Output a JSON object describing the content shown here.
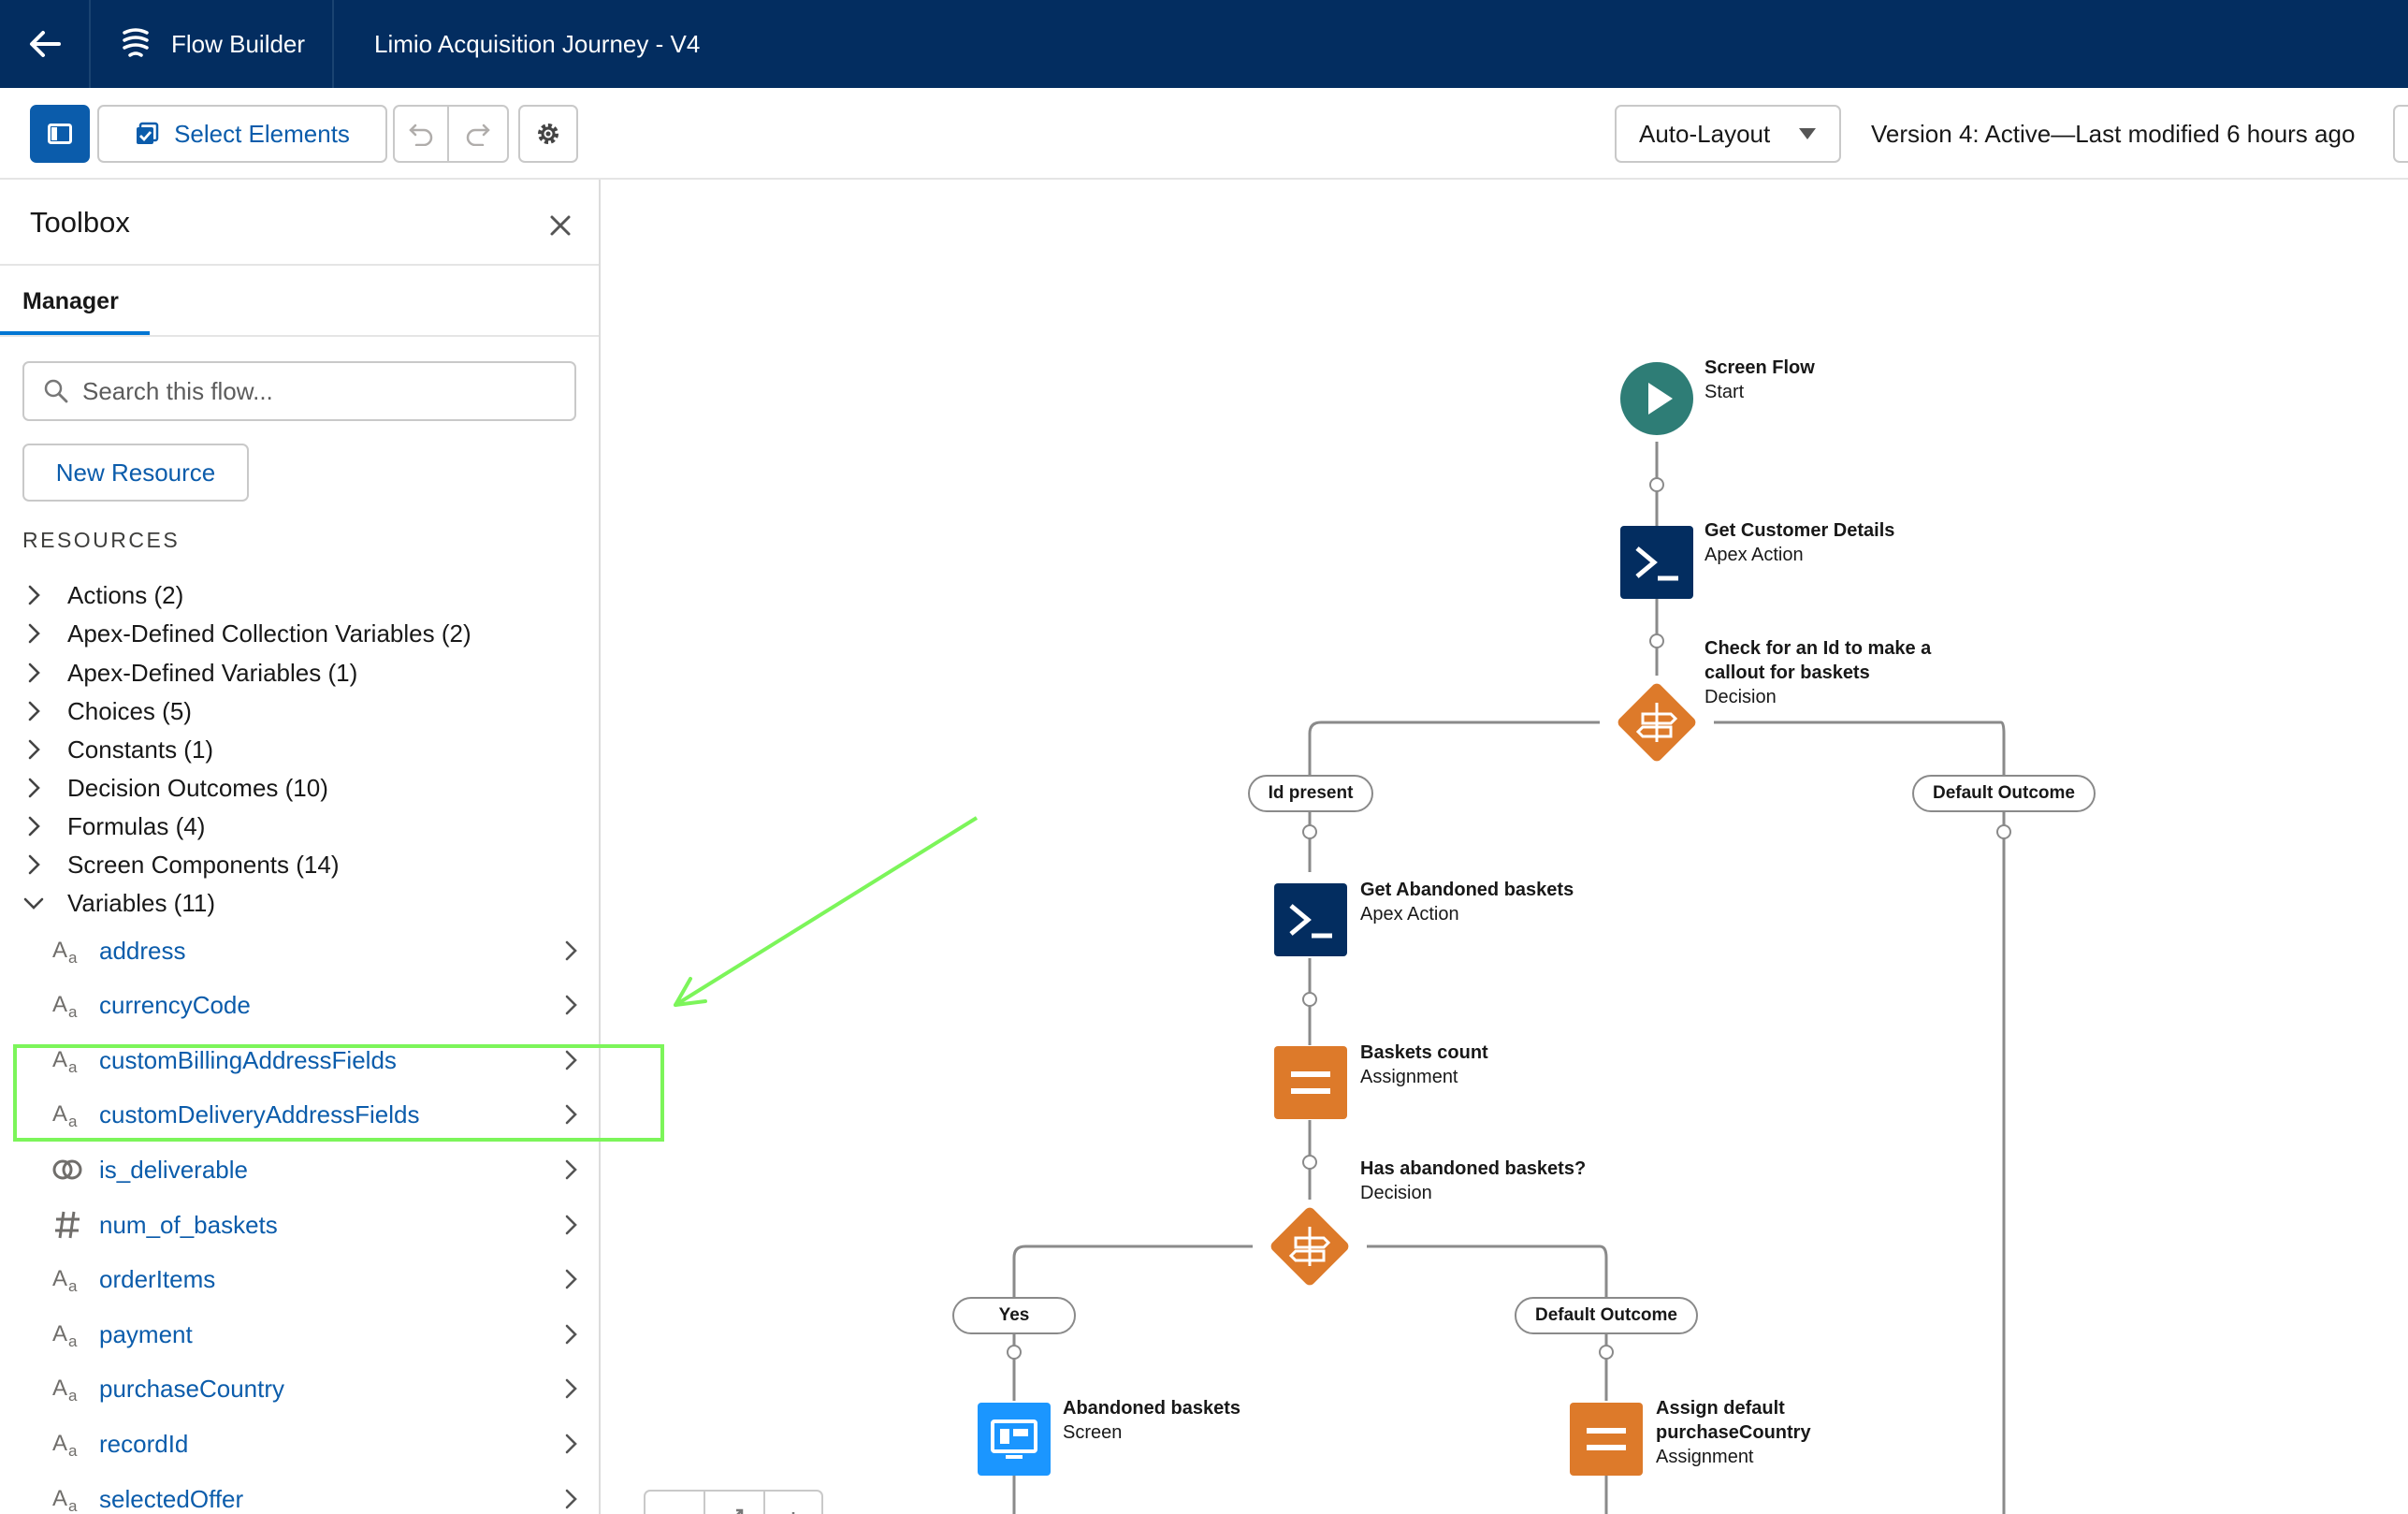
{
  "header": {
    "app_name": "Flow Builder",
    "flow_name": "Limio Acquisition Journey - V4"
  },
  "toolbar": {
    "select_elements": "Select Elements",
    "layout_mode": "Auto-Layout",
    "version_status": "Version 4: Active—Last modified 6 hours ago"
  },
  "toolbox": {
    "title": "Toolbox",
    "tab": "Manager",
    "search_placeholder": "Search this flow...",
    "new_resource": "New Resource",
    "resources_heading": "RESOURCES",
    "categories": [
      {
        "label": "Actions (2)",
        "expanded": false
      },
      {
        "label": "Apex-Defined Collection Variables (2)",
        "expanded": false
      },
      {
        "label": "Apex-Defined Variables (1)",
        "expanded": false
      },
      {
        "label": "Choices (5)",
        "expanded": false
      },
      {
        "label": "Constants (1)",
        "expanded": false
      },
      {
        "label": "Decision Outcomes (10)",
        "expanded": false
      },
      {
        "label": "Formulas (4)",
        "expanded": false
      },
      {
        "label": "Screen Components (14)",
        "expanded": false
      },
      {
        "label": "Variables (11)",
        "expanded": true
      }
    ],
    "variables": [
      {
        "name": "address",
        "type_icon": "text-type-icon"
      },
      {
        "name": "currencyCode",
        "type_icon": "text-type-icon"
      },
      {
        "name": "customBillingAddressFields",
        "type_icon": "text-type-icon",
        "highlighted": true
      },
      {
        "name": "customDeliveryAddressFields",
        "type_icon": "text-type-icon",
        "highlighted": true
      },
      {
        "name": "is_deliverable",
        "type_icon": "boolean-type-icon"
      },
      {
        "name": "num_of_baskets",
        "type_icon": "number-type-icon"
      },
      {
        "name": "orderItems",
        "type_icon": "text-type-icon"
      },
      {
        "name": "payment",
        "type_icon": "text-type-icon"
      },
      {
        "name": "purchaseCountry",
        "type_icon": "text-type-icon"
      },
      {
        "name": "recordId",
        "type_icon": "text-type-icon"
      },
      {
        "name": "selectedOffer",
        "type_icon": "text-type-icon"
      }
    ]
  },
  "canvas": {
    "nodes": {
      "start": {
        "title": "Screen Flow",
        "subtitle": "Start"
      },
      "get_customer": {
        "title": "Get Customer Details",
        "subtitle": "Apex Action"
      },
      "check_id": {
        "title": "Check for an Id to make a callout for baskets",
        "title_line1": "Check for an Id to make a",
        "title_line2": "callout for baskets",
        "subtitle": "Decision"
      },
      "get_baskets": {
        "title": "Get Abandoned baskets",
        "subtitle": "Apex Action"
      },
      "baskets_count": {
        "title": "Baskets count",
        "subtitle": "Assignment"
      },
      "has_baskets": {
        "title": "Has abandoned baskets?",
        "subtitle": "Decision"
      },
      "abandoned_screen": {
        "title": "Abandoned baskets",
        "subtitle": "Screen"
      },
      "assign_default": {
        "title_line1": "Assign default",
        "title_line2": "purchaseCountry",
        "subtitle": "Assignment"
      }
    },
    "outcomes": {
      "id_present": "Id present",
      "default_outcome_1": "Default Outcome",
      "yes": "Yes",
      "default_outcome_2": "Default Outcome"
    }
  },
  "colors": {
    "header_bg": "#032d60",
    "brand_blue": "#0b5cab",
    "start_teal": "#2e7d76",
    "action_navy": "#032d60",
    "decision_orange": "#dd7a2a",
    "screen_blue": "#1b96ff",
    "highlight_green": "#7cf55a"
  }
}
